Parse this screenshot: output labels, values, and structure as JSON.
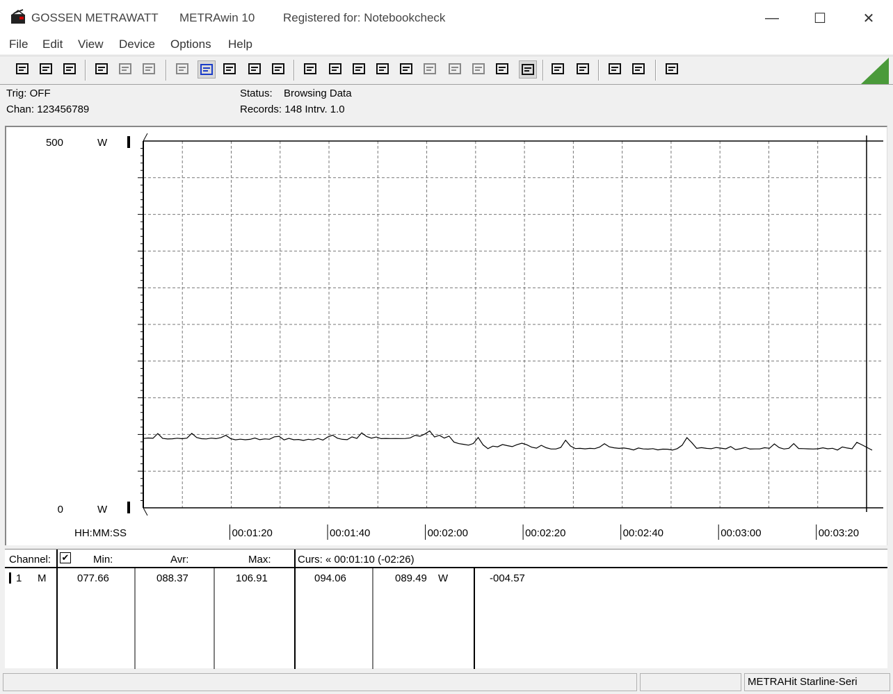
{
  "window": {
    "company": "GOSSEN METRAWATT",
    "app": "METRAwin 10",
    "registered": "Registered for: Notebookcheck",
    "minimize_glyph": "—",
    "maximize_glyph": "☐",
    "close_glyph": "✕"
  },
  "menu": [
    "File",
    "Edit",
    "View",
    "Device",
    "Options",
    "Help"
  ],
  "toolbar_icons": [
    "save-disk-icon",
    "save-as-disk-icon",
    "open-folder-icon",
    "device-connect-icon",
    "device-setup-icon",
    "device-read-icon",
    "display-icon",
    "waveform-view-icon",
    "crosshair-icon",
    "table-view-icon",
    "bar-view-icon",
    "export-icon",
    "import-icon",
    "list-icon",
    "monitor-icon",
    "function-icon",
    "record-icon",
    "wave-icon",
    "wave2-icon",
    "trigger-icon",
    "timer-icon",
    "print-preview-icon",
    "print-icon",
    "zoom-icon",
    "zoom-area-icon",
    "comment-icon"
  ],
  "info": {
    "trig": "Trig: OFF",
    "chan": "Chan:  123456789",
    "status_label": "Status:",
    "status_value": "Browsing Data",
    "records": "Records: 148   Intrv. 1.0"
  },
  "chart_data": {
    "type": "line",
    "ylim": [
      0,
      500
    ],
    "y_top_label": "500",
    "y_bottom_label": "0",
    "y_unit": "W",
    "x_axis_label": "HH:MM:SS",
    "xlim_seconds": [
      62,
      210
    ],
    "x_ticks": [
      "00:01:20",
      "00:01:40",
      "00:02:00",
      "00:02:20",
      "00:02:40",
      "00:03:00",
      "00:03:20"
    ],
    "series": [
      {
        "values": [
          94.5,
          95.2,
          94.8,
          101.2,
          94.6,
          93.8,
          94.1,
          94.9,
          94.2,
          95.0,
          101.5,
          95.8,
          94.2,
          93.9,
          95.0,
          94.3,
          95.7,
          98.9,
          94.3,
          92.7,
          93.6,
          92.8,
          93.4,
          95.2,
          92.9,
          93.9,
          93.5,
          96.8,
          97.4,
          92.6,
          94.7,
          92.8,
          93.2,
          91.9,
          93.5,
          92.5,
          94.5,
          92.3,
          96.5,
          99.1,
          94.9,
          93.4,
          92.9,
          96.7,
          94.6,
          102.2,
          97.3,
          95.0,
          96.5,
          94.3,
          94.6,
          94.4,
          94.5,
          94.4,
          94.5,
          95.4,
          98.9,
          97.5,
          100.6,
          104.8,
          96.5,
          98.9,
          95.1,
          97.7,
          89.7,
          87.5,
          86.6,
          85.4,
          87.7,
          95.8,
          85.8,
          80.7,
          84.1,
          83.1,
          86.3,
          84.8,
          83.4,
          86.1,
          88.1,
          86.0,
          82.7,
          81.3,
          85.2,
          81.9,
          80.2,
          80.2,
          82.3,
          92.1,
          84.3,
          80.8,
          81.1,
          80.4,
          81.1,
          80.7,
          82.8,
          87.4,
          83.1,
          81.8,
          81.1,
          81.5,
          80.6,
          78.9,
          81.5,
          80.3,
          80.0,
          80.7,
          79.0,
          80.0,
          79.9,
          78.7,
          80.7,
          85.3,
          95.6,
          88.8,
          81.1,
          82.0,
          81.1,
          80.6,
          82.2,
          81.3,
          80.4,
          83.5,
          79.4,
          80.5,
          82.3,
          80.1,
          80.3,
          80.3,
          81.9,
          81.2,
          87.1,
          82.1,
          80.2,
          81.2,
          87.5,
          80.9,
          80.7,
          80.4,
          80.2,
          80.5,
          81.8,
          80.5,
          81.2,
          78.8,
          83.0,
          81.5,
          80.5,
          89.2,
          86.1,
          78.6
        ]
      }
    ]
  },
  "channels": {
    "headers": {
      "channel": "Channel:",
      "min": "Min:",
      "avr": "Avr:",
      "max": "Max:",
      "curs": "Curs: « 00:01:10 (-02:26)"
    },
    "row": {
      "num": "1",
      "mode": "M",
      "min": "077.66",
      "avr": "088.37",
      "max": "106.91",
      "c1": "094.06",
      "c2": "089.49",
      "unit": "W",
      "diff": "-004.57"
    }
  },
  "statusbar": {
    "device": "METRAHit Starline-Seri"
  }
}
